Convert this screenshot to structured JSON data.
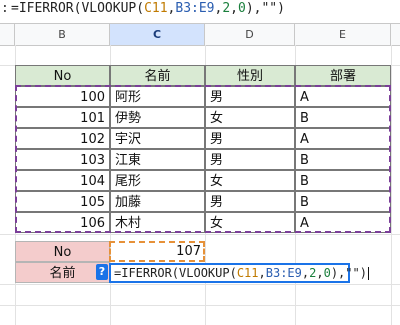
{
  "formula": {
    "prefix": ":",
    "text_parts": [
      "=IFERROR(VLOOKUP(",
      "C11",
      ",",
      "B3:E9",
      ",",
      "2",
      ",",
      "0",
      "),\"\")"
    ]
  },
  "columns": [
    "B",
    "C",
    "D",
    "E"
  ],
  "table": {
    "headers": [
      "No",
      "名前",
      "性別",
      "部署"
    ],
    "rows": [
      [
        "100",
        "阿形",
        "男",
        "A"
      ],
      [
        "101",
        "伊勢",
        "女",
        "B"
      ],
      [
        "102",
        "宇沢",
        "男",
        "A"
      ],
      [
        "103",
        "江東",
        "男",
        "B"
      ],
      [
        "104",
        "尾形",
        "女",
        "B"
      ],
      [
        "105",
        "加藤",
        "男",
        "B"
      ],
      [
        "106",
        "木村",
        "女",
        "A"
      ]
    ]
  },
  "lookup": {
    "no_label": "No",
    "no_value": "107",
    "name_label": "名前",
    "help_icon": "?"
  },
  "colors": {
    "header_fill": "#d9ead3",
    "lookup_label_fill": "#f4cccc",
    "table_range_highlight": "#7b3f99",
    "c11_highlight": "#e69138",
    "active_edit": "#1a73e8"
  }
}
